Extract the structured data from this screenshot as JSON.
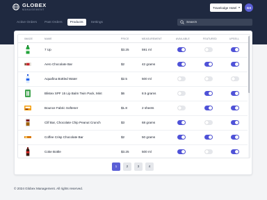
{
  "brand": {
    "name": "GLOBEX",
    "subtitle": "MANAGEMENT"
  },
  "header": {
    "hotel_select": "Travelodge Hotel",
    "avatar_initials": "GX",
    "search_placeholder": "Search"
  },
  "nav": [
    {
      "label": "Active Orders",
      "active": false
    },
    {
      "label": "Past Orders",
      "active": false
    },
    {
      "label": "Products",
      "active": true
    },
    {
      "label": "Settings",
      "active": false
    }
  ],
  "columns": {
    "image": "IMAGE",
    "name": "NAME",
    "price": "PRICE",
    "measurement": "MEASUREMENT",
    "available": "AVAILABLE",
    "featured": "FEATURED",
    "upsell": "UPSELL"
  },
  "rows": [
    {
      "image_icon": "7up-bottle-icon",
      "name": "7 Up",
      "price": "$3.25",
      "measurement": "591 ml",
      "available": true,
      "featured": false,
      "upsell": true
    },
    {
      "image_icon": "chocolate-bar-icon",
      "name": "Aero Chocolate Bar",
      "price": "$2",
      "measurement": "42 grams",
      "available": true,
      "featured": true,
      "upsell": true
    },
    {
      "image_icon": "water-bottle-icon",
      "name": "Aquafina Bottled Water",
      "price": "$2.5",
      "measurement": "500 ml",
      "available": false,
      "featured": false,
      "upsell": false
    },
    {
      "image_icon": "lip-balm-icon",
      "name": "Blistex SPF 15 Lip Balm Twin Pack, Mint",
      "price": "$6",
      "measurement": "8.5 grams",
      "available": false,
      "featured": true,
      "upsell": true
    },
    {
      "image_icon": "fabric-softener-icon",
      "name": "Bounce Fabric Softener",
      "price": "$1.8",
      "measurement": "2 sheets",
      "available": false,
      "featured": true,
      "upsell": true
    },
    {
      "image_icon": "candy-bar-icon",
      "name": "Clif Bar, Chocolate Chip Peanut Crunch",
      "price": "$3",
      "measurement": "68 grams",
      "available": true,
      "featured": false,
      "upsell": true
    },
    {
      "image_icon": "wafer-bar-icon",
      "name": "Coffee Crisp Chocolate Bar",
      "price": "$2",
      "measurement": "50 grams",
      "available": true,
      "featured": true,
      "upsell": true
    },
    {
      "image_icon": "coke-bottle-icon",
      "name": "Coke Bottle",
      "price": "$3.25",
      "measurement": "500 ml",
      "available": true,
      "featured": false,
      "upsell": true
    }
  ],
  "pagination": {
    "pages": [
      "1",
      "2",
      "3",
      "4"
    ],
    "current": "1"
  },
  "footer": {
    "text": "© 2024 Globex Management. All rights reserved."
  },
  "colors": {
    "header_bg": "#1f2940",
    "accent": "#4f52d8",
    "toggle_off": "#e5e7eb"
  }
}
